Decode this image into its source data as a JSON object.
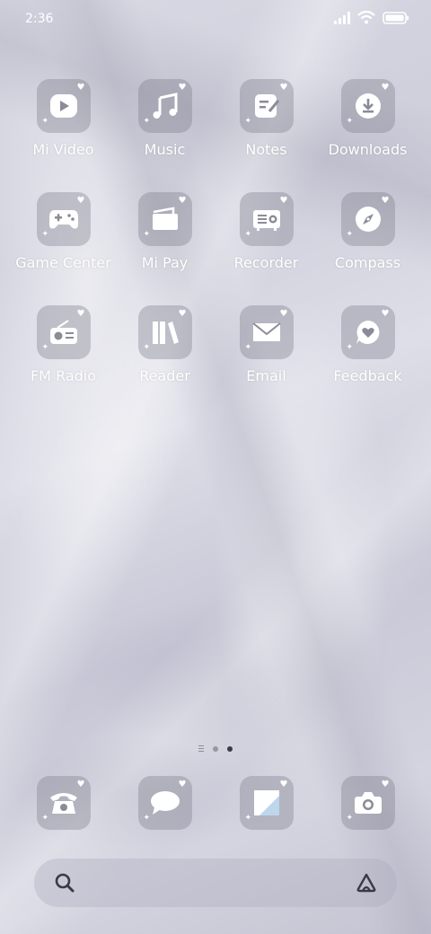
{
  "status": {
    "time": "2:36"
  },
  "apps": [
    {
      "label": "Mi Video",
      "icon": "play-icon"
    },
    {
      "label": "Music",
      "icon": "music-note-icon"
    },
    {
      "label": "Notes",
      "icon": "notes-icon"
    },
    {
      "label": "Downloads",
      "icon": "download-icon"
    },
    {
      "label": "Game Center",
      "icon": "gamepad-icon"
    },
    {
      "label": "Mi Pay",
      "icon": "wallet-icon"
    },
    {
      "label": "Recorder",
      "icon": "recorder-icon"
    },
    {
      "label": "Compass",
      "icon": "compass-icon"
    },
    {
      "label": "FM Radio",
      "icon": "radio-icon"
    },
    {
      "label": "Reader",
      "icon": "books-icon"
    },
    {
      "label": "Email",
      "icon": "envelope-icon"
    },
    {
      "label": "Feedback",
      "icon": "feedback-icon"
    }
  ],
  "dock": [
    {
      "name": "Phone",
      "icon": "telephone-icon"
    },
    {
      "name": "Messages",
      "icon": "chat-bubble-icon"
    },
    {
      "name": "Gallery",
      "icon": "gallery-icon"
    },
    {
      "name": "Camera",
      "icon": "camera-icon"
    }
  ],
  "page_indicator": {
    "pages": 2,
    "current": 2
  }
}
